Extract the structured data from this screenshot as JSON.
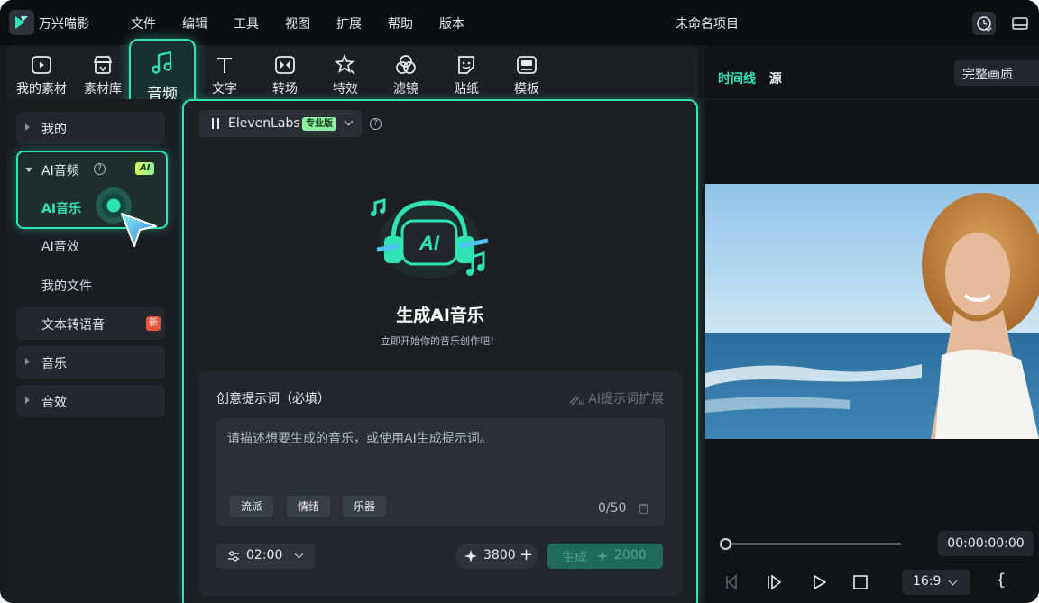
{
  "titlebar": {
    "app_name": "万兴喵影",
    "menu": [
      "文件",
      "编辑",
      "工具",
      "视图",
      "扩展",
      "帮助",
      "版本"
    ],
    "project_title": "未命名项目"
  },
  "toolbar": {
    "tabs": [
      {
        "label": "我的素材",
        "icon": "media-icon"
      },
      {
        "label": "素材库",
        "icon": "store-icon"
      },
      {
        "label": "音频",
        "icon": "music-note-icon",
        "active": true
      },
      {
        "label": "文字",
        "icon": "text-icon"
      },
      {
        "label": "转场",
        "icon": "transition-icon"
      },
      {
        "label": "特效",
        "icon": "effects-icon"
      },
      {
        "label": "滤镜",
        "icon": "filter-icon"
      },
      {
        "label": "贴纸",
        "icon": "sticker-icon"
      },
      {
        "label": "模板",
        "icon": "template-icon"
      }
    ]
  },
  "sidebar": {
    "mine": "我的",
    "ai_audio": {
      "label": "AI音频",
      "badge": "AI",
      "help": "?"
    },
    "ai_music": "AI音乐",
    "ai_sfx": "AI音效",
    "my_files": "我的文件",
    "tts": {
      "label": "文本转语音",
      "badge": "新"
    },
    "music": "音乐",
    "sfx": "音效"
  },
  "content": {
    "model": {
      "name": "ElevenLabs",
      "badge": "专业版",
      "help": "?"
    },
    "hero_title": "生成AI音乐",
    "hero_subtitle": "立即开始你的音乐创作吧！",
    "hero_icon_text": "AI",
    "prompt": {
      "title": "创意提示词（必填）",
      "extend_label": "AI提示词扩展",
      "placeholder": "请描述想要生成的音乐，或使用AI生成提示词。",
      "tags": [
        "流派",
        "情绪",
        "乐器"
      ],
      "counter": "0/50"
    },
    "duration": "02:00",
    "credits": "3800",
    "generate": {
      "label": "生成",
      "cost": "2000"
    }
  },
  "preview": {
    "tab_timeline": "时间线",
    "tab_source": "源",
    "quality": "完整画质",
    "progress": 0,
    "timecode": "00:00:00:00",
    "aspect_ratio": "16:9",
    "brace": "{"
  },
  "colors": {
    "accent": "#2fe3b5",
    "background": "#17191d",
    "titlebar": "#0d0e11"
  }
}
